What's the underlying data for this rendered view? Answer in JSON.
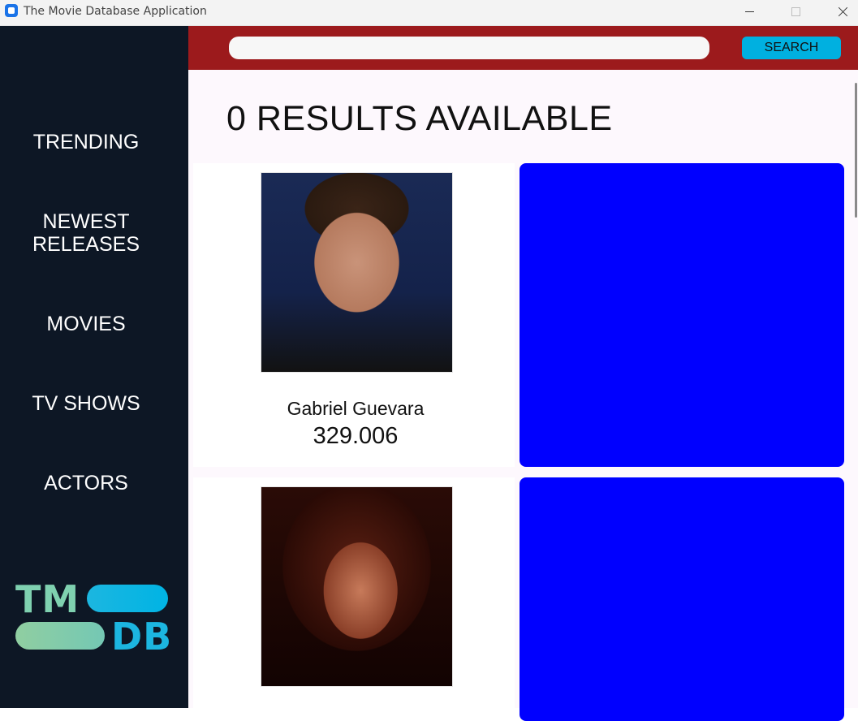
{
  "window": {
    "title": "The Movie Database Application"
  },
  "sidebar": {
    "items": [
      {
        "label": "TRENDING"
      },
      {
        "label": "NEWEST RELEASES"
      },
      {
        "label": "MOVIES"
      },
      {
        "label": "TV SHOWS"
      },
      {
        "label": "ACTORS"
      }
    ],
    "logo": {
      "line1": "TM",
      "line2": "DB"
    }
  },
  "search": {
    "value": "",
    "placeholder": "",
    "button_label": "SEARCH"
  },
  "results": {
    "title": "0 RESULTS AVAILABLE",
    "cards": [
      {
        "name": "Gabriel Guevara",
        "popularity": "329.006"
      },
      {
        "name": "",
        "popularity": ""
      }
    ]
  },
  "colors": {
    "sidebar_bg": "#0d1725",
    "header_bg": "#9c1a1c",
    "search_button": "#00b0e0",
    "card_placeholder": "#0000ff"
  }
}
